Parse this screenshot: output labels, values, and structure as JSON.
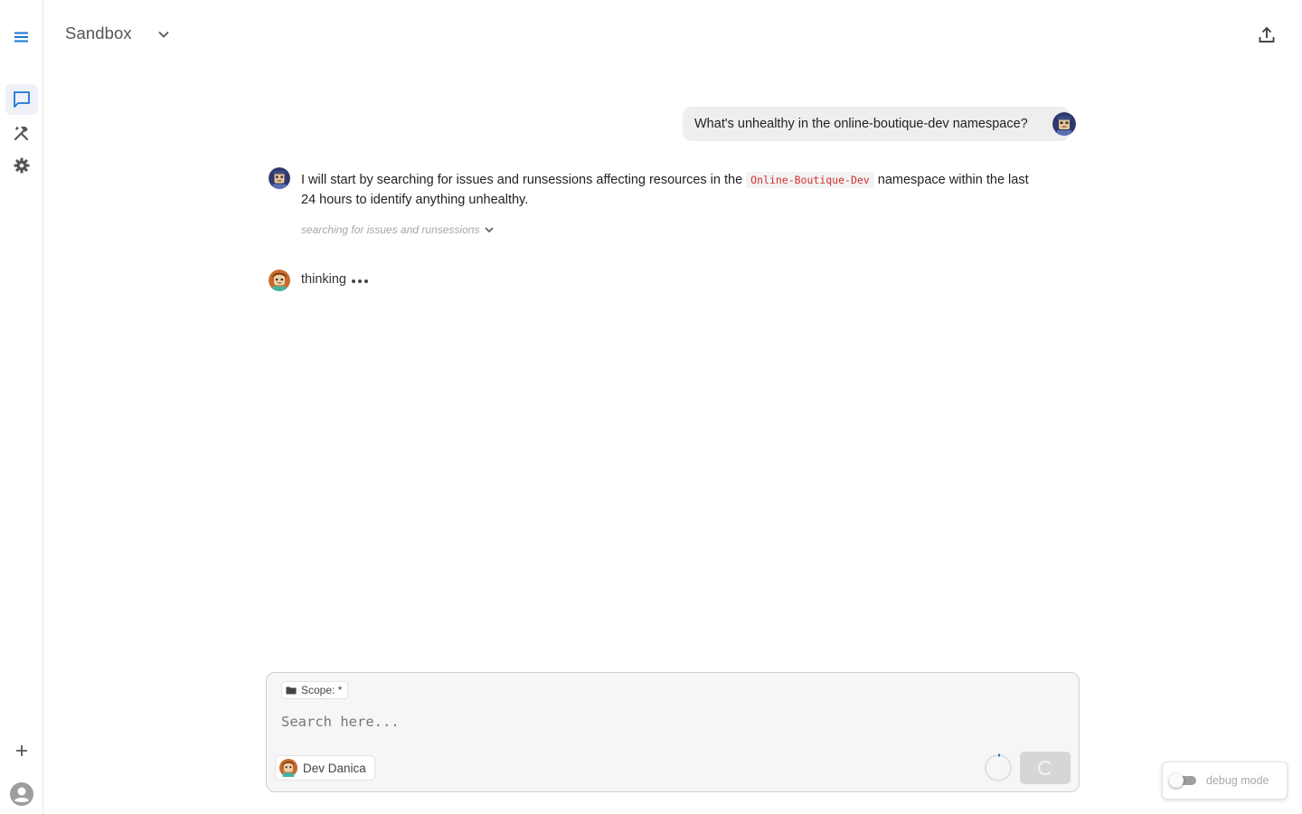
{
  "header": {
    "workspace_title": "Sandbox",
    "share_icon": "upload-share-icon"
  },
  "sidebar": {
    "items": [
      {
        "name": "menu",
        "icon": "hamburger-menu-icon"
      },
      {
        "name": "chat",
        "icon": "chat-bubble-icon",
        "active": true
      },
      {
        "name": "tools",
        "icon": "hammer-wrench-icon"
      },
      {
        "name": "settings",
        "icon": "gear-icon"
      },
      {
        "name": "new",
        "icon": "plus-icon"
      },
      {
        "name": "account",
        "icon": "account-circle-icon"
      }
    ]
  },
  "chat": {
    "user_message": "What's unhealthy in the online-boutique-dev namespace?",
    "assistant_message": {
      "text_before": "I will start by searching for issues and runsessions affecting resources in the ",
      "code": "Online-Boutique-Dev",
      "text_after": " namespace within the last 24 hours to identify anything unhealthy."
    },
    "tool_call_label": "searching for issues and runsessions",
    "thinking_label": "thinking"
  },
  "composer": {
    "scope_label": "Scope: *",
    "search_placeholder": "Search here...",
    "search_value": "",
    "persona_name": "Dev Danica"
  },
  "debug": {
    "label": "debug mode",
    "enabled": false
  },
  "colors": {
    "accent": "#1976d2",
    "code_text": "#d32f2f",
    "user_bubble": "#eeeeee",
    "composer_bg": "#f6f6f6"
  }
}
